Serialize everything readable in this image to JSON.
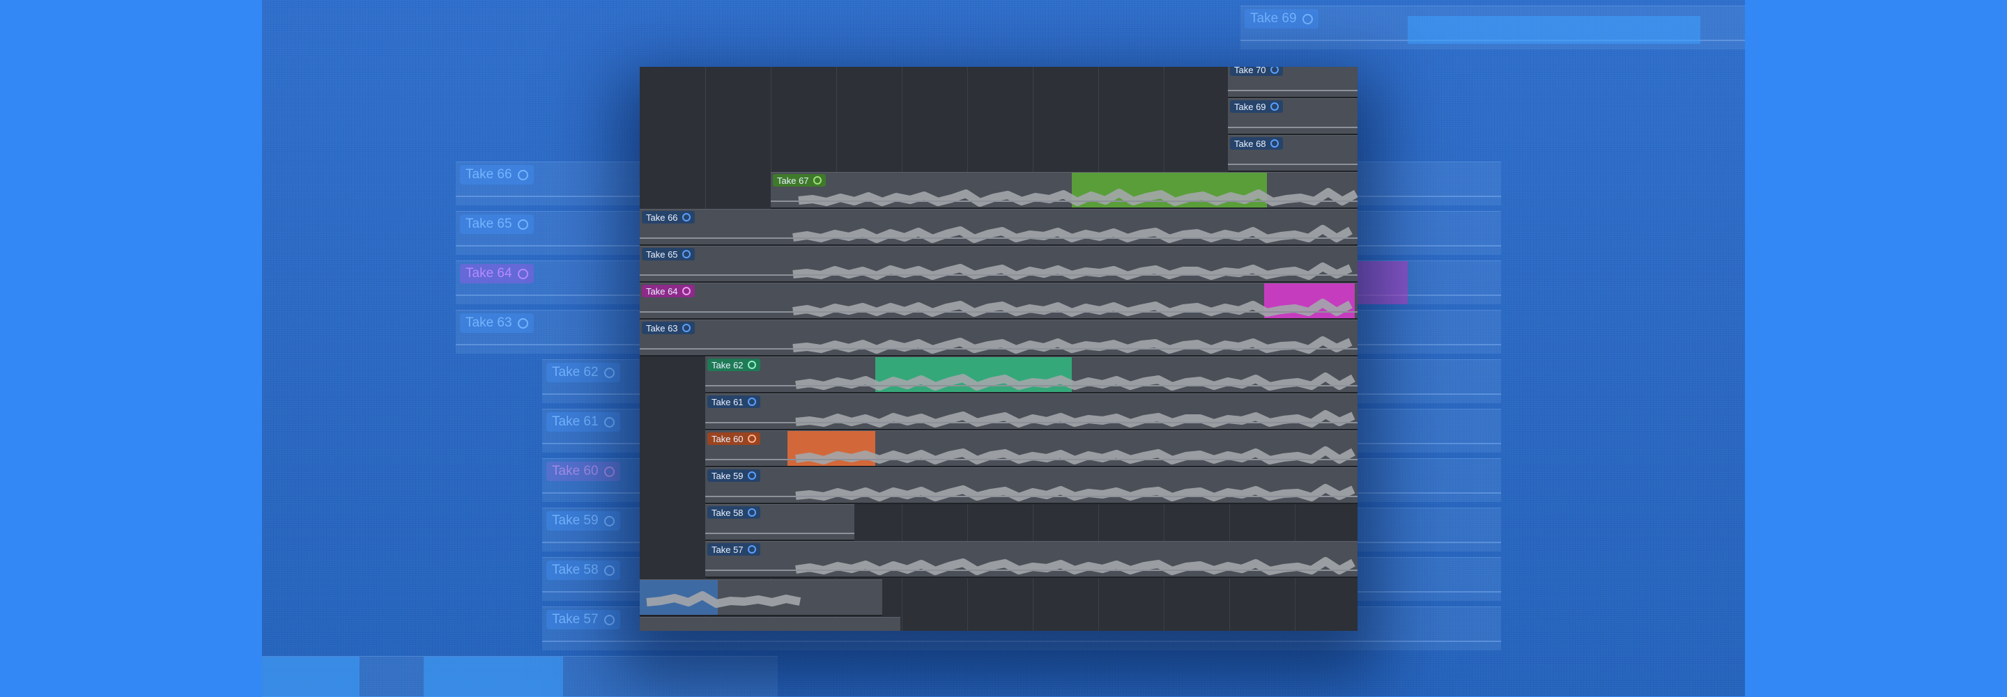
{
  "background_takes": [
    {
      "label": "Take 69"
    },
    {
      "label": "Take 66"
    },
    {
      "label": "Take 65"
    },
    {
      "label": "Take 64"
    },
    {
      "label": "Take 63"
    },
    {
      "label": "Take 62"
    },
    {
      "label": "Take 61"
    },
    {
      "label": "Take 60"
    },
    {
      "label": "Take 59"
    },
    {
      "label": "Take 58"
    },
    {
      "label": "Take 57"
    }
  ],
  "takes": [
    {
      "label": "Take 70",
      "icon": "take-circle-icon"
    },
    {
      "label": "Take 69",
      "icon": "take-circle-icon"
    },
    {
      "label": "Take 68",
      "icon": "take-circle-icon"
    },
    {
      "label": "Take 67",
      "icon": "take-circle-icon",
      "label_color": "#3f7a2a",
      "selected_color": "#5a9e3a"
    },
    {
      "label": "Take 66",
      "icon": "take-circle-icon"
    },
    {
      "label": "Take 65",
      "icon": "take-circle-icon"
    },
    {
      "label": "Take 64",
      "icon": "take-circle-icon",
      "label_color": "#8e2a8a",
      "selected_color": "#c53cbf"
    },
    {
      "label": "Take 63",
      "icon": "take-circle-icon"
    },
    {
      "label": "Take 62",
      "icon": "take-circle-icon",
      "label_color": "#1f7a56",
      "selected_color": "#35a87a"
    },
    {
      "label": "Take 61",
      "icon": "take-circle-icon"
    },
    {
      "label": "Take 60",
      "icon": "take-circle-icon",
      "label_color": "#9a4420",
      "selected_color": "#d2683a"
    },
    {
      "label": "Take 59",
      "icon": "take-circle-icon"
    },
    {
      "label": "Take 58",
      "icon": "take-circle-icon"
    },
    {
      "label": "Take 57",
      "icon": "take-circle-icon"
    }
  ],
  "colors": {
    "background": "#3388f5",
    "window": "#2d3036",
    "region": "#4b4f57",
    "waveform": "#a3a6ab",
    "comp_region": "#3e6aa3"
  }
}
